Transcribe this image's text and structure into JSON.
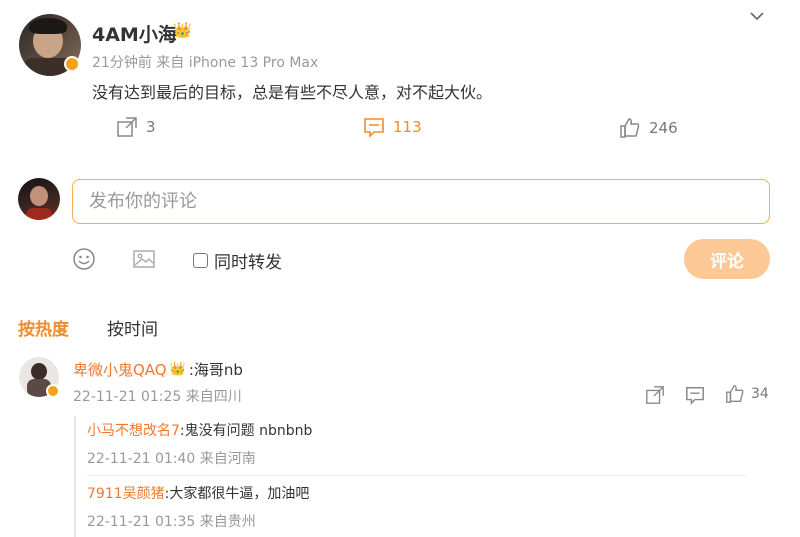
{
  "post": {
    "author": "4AM小海",
    "meta": "21分钟前 来自 iPhone 13 Pro Max",
    "text": "没有达到最后的目标，总是有些不尽人意，对不起大伙。",
    "repost_count": "3",
    "comment_count": "113",
    "like_count": "246"
  },
  "composer": {
    "placeholder": "发布你的评论",
    "same_time_repost_label": "同时转发",
    "submit_label": "评论"
  },
  "sort_tabs": {
    "hot": "按热度",
    "time": "按时间"
  },
  "comment": {
    "author": "卑微小鬼QAQ",
    "text": ":海哥nb",
    "meta": "22-11-21 01:25 来自四川",
    "like_count": "34",
    "replies": [
      {
        "author": "小马不想改名7",
        "text": ":鬼没有问题 nbnbnb",
        "meta": "22-11-21 01:40 来自河南"
      },
      {
        "author": "7911吴颜猪",
        "text": ":大家都很牛逼，加油吧",
        "meta": "22-11-21 01:35 来自贵州"
      }
    ]
  },
  "colors": {
    "accent": "#f28c28",
    "reply_name": "#f0792d",
    "submit_bg": "#fcc895",
    "input_border": "#f3b04e"
  }
}
